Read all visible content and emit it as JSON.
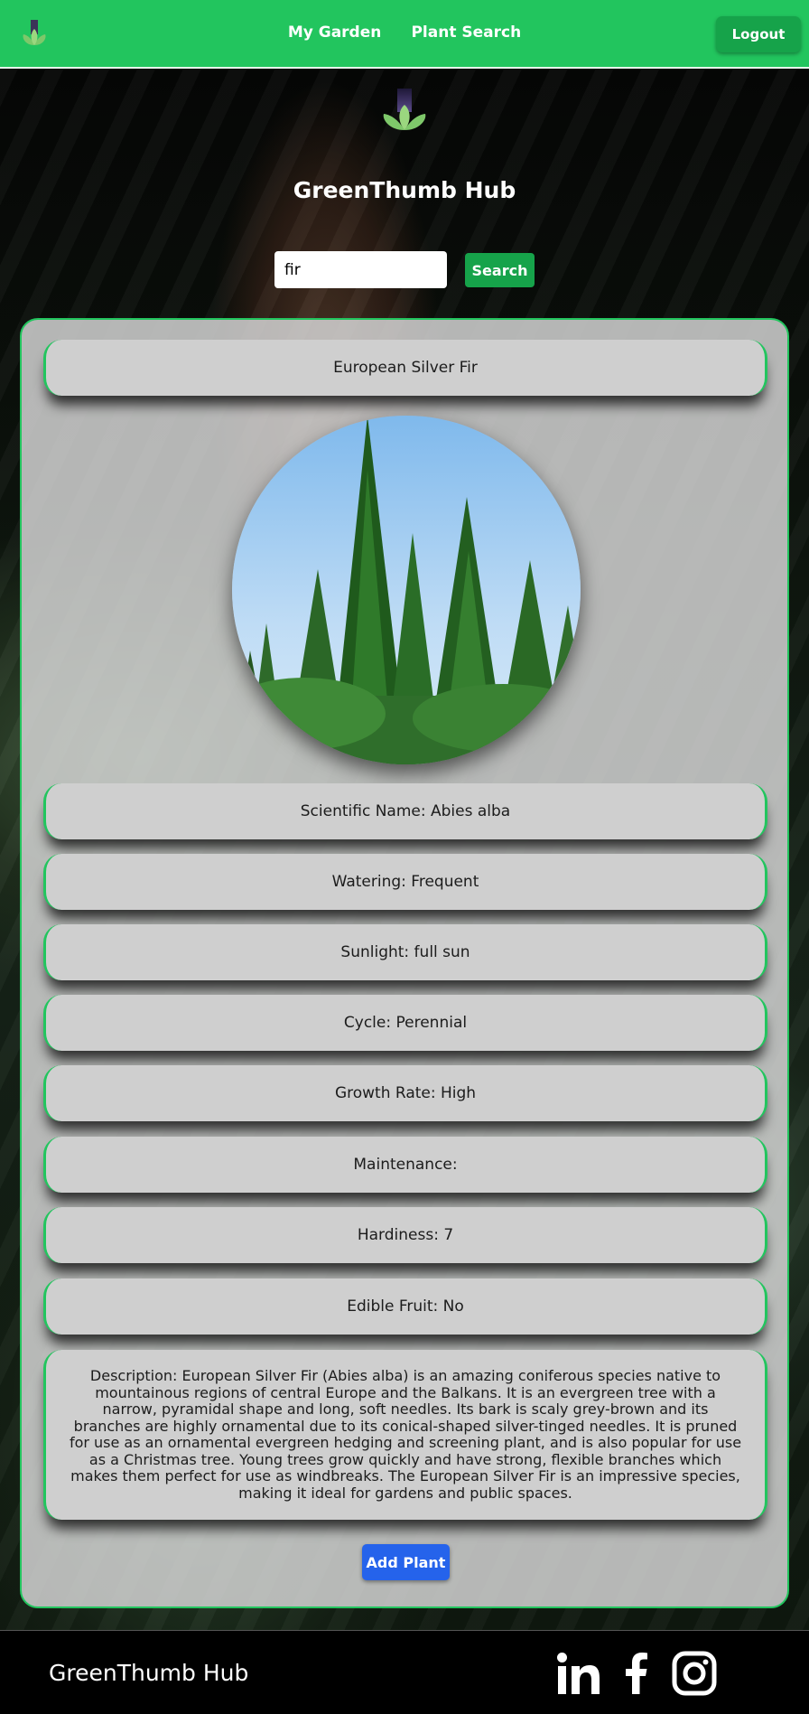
{
  "header": {
    "logo_icon": "lotus-icon",
    "nav": [
      "My Garden",
      "Plant Search"
    ],
    "logout_label": "Logout"
  },
  "hero": {
    "logo_icon": "lotus-icon",
    "title": "GreenThumb Hub"
  },
  "search": {
    "value": "fir",
    "button_label": "Search"
  },
  "result": {
    "common_name": "European Silver Fir",
    "image_icon": "fir-tree-photo",
    "fields": [
      "Scientific Name: Abies alba",
      "Watering: Frequent",
      "Sunlight: full sun",
      "Cycle: Perennial",
      "Growth Rate: High",
      "Maintenance:",
      "Hardiness: 7",
      "Edible Fruit: No"
    ],
    "description": "Description: European Silver Fir (Abies alba) is an amazing coniferous species native to mountainous regions of central Europe and the Balkans. It is an evergreen tree with a narrow, pyramidal shape and long, soft needles. Its bark is scaly grey-brown and its branches are highly ornamental due to its conical-shaped silver-tinged needles. It is pruned for use as an ornamental evergreen hedging and screening plant, and is also popular for use as a Christmas tree. Young trees grow quickly and have strong, flexible branches which makes them perfect for use as windbreaks. The European Silver Fir is an impressive species, making it ideal for gardens and public spaces.",
    "add_label": "Add Plant"
  },
  "footer": {
    "title": "GreenThumb Hub",
    "social_icons": [
      "linkedin-icon",
      "facebook-icon",
      "instagram-icon"
    ]
  },
  "colors": {
    "brand_green": "#22c55e",
    "button_green": "#16a34a",
    "add_blue": "#2563eb"
  }
}
